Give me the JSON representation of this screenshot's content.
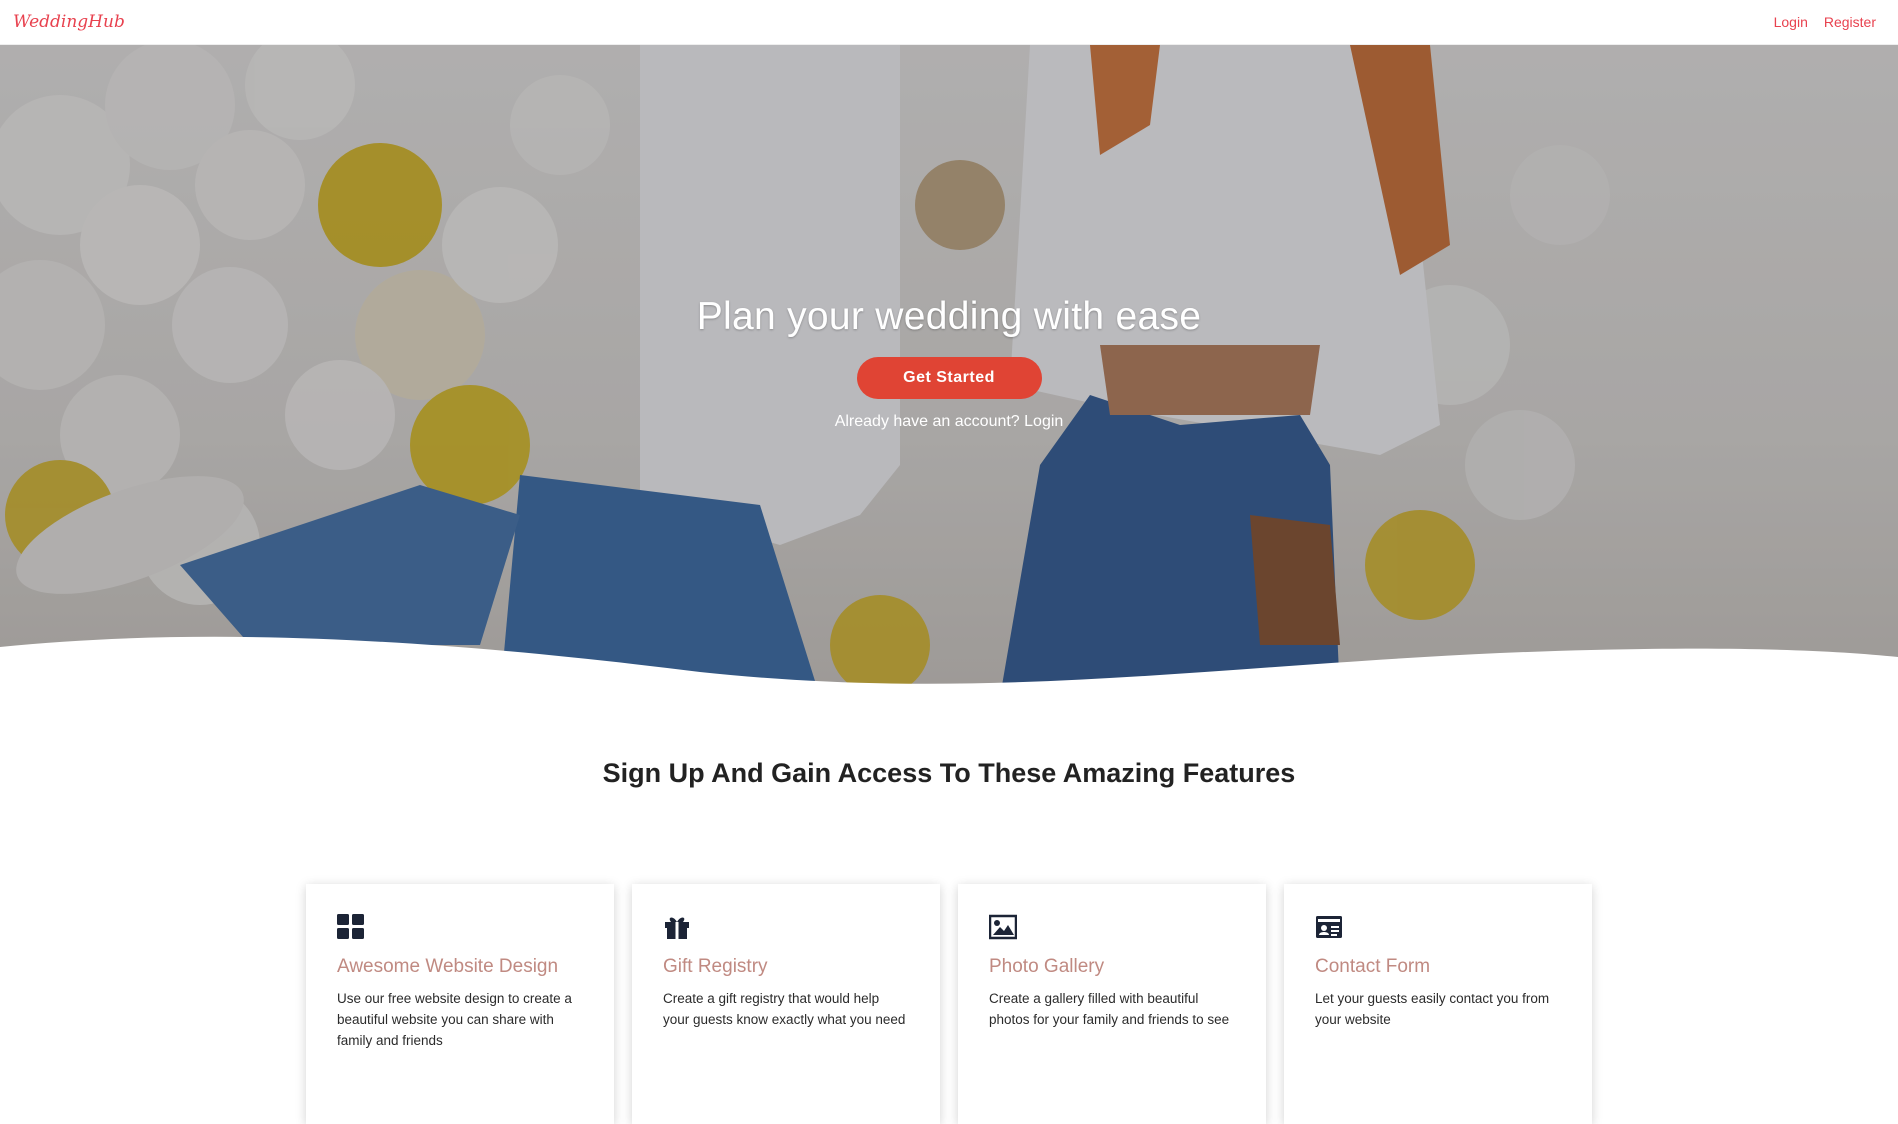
{
  "navbar": {
    "brand": "WeddingHub",
    "login": "Login",
    "register": "Register"
  },
  "hero": {
    "title": "Plan your wedding with ease",
    "cta": "Get Started",
    "account_prefix": "Already have an account?",
    "account_login": "Login"
  },
  "features": {
    "title": "Sign Up And Gain Access To These Amazing Features",
    "cards": [
      {
        "icon": "grid-icon",
        "title": "Awesome Website Design",
        "text": "Use our free website design to create a beautiful website you can share with family and friends"
      },
      {
        "icon": "gift-icon",
        "title": "Gift Registry",
        "text": "Create a gift registry that would help your guests know exactly what you need"
      },
      {
        "icon": "image-icon",
        "title": "Photo Gallery",
        "text": "Create a gallery filled with beautiful photos for your family and friends to see"
      },
      {
        "icon": "id-card-icon",
        "title": "Contact Form",
        "text": "Let your guests easily contact you from your website"
      }
    ]
  },
  "colors": {
    "brand": "#e8424f",
    "cta": "#e04434",
    "card_title": "#c08a82"
  }
}
